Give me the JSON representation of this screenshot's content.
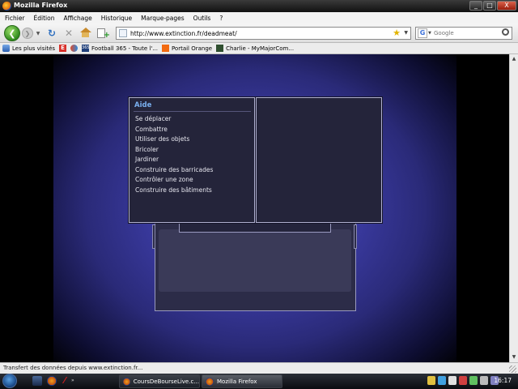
{
  "window": {
    "title": "Mozilla Firefox",
    "buttons": [
      "_",
      "□",
      "X"
    ]
  },
  "menubar": {
    "items": [
      "Fichier",
      "Édition",
      "Affichage",
      "Historique",
      "Marque-pages",
      "Outils",
      "?"
    ]
  },
  "navbar": {
    "back_glyph": "❮",
    "forward_glyph": "❯",
    "dropdown_glyph": "▼",
    "reload_glyph": "↻",
    "stop_glyph": "✕",
    "url": "http://www.extinction.fr/deadmeat/",
    "search_placeholder": "Google",
    "search_engine_glyph": "G",
    "star_glyph": "★"
  },
  "bookmarks": {
    "items": [
      {
        "label": "Les plus visités",
        "icon": "most-visited-icon"
      },
      {
        "label": "",
        "icon": "letter-e-icon",
        "glyph": "E"
      },
      {
        "label": "",
        "icon": "bookmark-multicolor-icon"
      },
      {
        "label": "Football 365 - Toute l'...",
        "icon": "football365-icon",
        "glyph": "365"
      },
      {
        "label": "Portail Orange",
        "icon": "orange-icon"
      },
      {
        "label": "Charlie - MyMajorCom...",
        "icon": "charlie-icon"
      }
    ]
  },
  "game": {
    "help_panel": {
      "title": "Aide",
      "items": [
        "Se déplacer",
        "Combattre",
        "Utiliser des objets",
        "Bricoler",
        "Jardiner",
        "Construire des barricades",
        "Contrôler une zone",
        "Construire des bâtiments"
      ]
    }
  },
  "statusbar": {
    "text": "Transfert des données depuis www.extinction.fr..."
  },
  "taskbar": {
    "tasks": [
      {
        "label": "CoursDeBourseLive.c..."
      },
      {
        "label": "Mozilla Firefox"
      }
    ],
    "clock": "16:17",
    "quicklaunch_more": "»"
  },
  "colors": {
    "page_bg": "#000000",
    "glow": "#4a4ab0",
    "panel_bg": "#24243a",
    "panel_title": "#7ab0f0",
    "menu_text": "#e6e6ee"
  }
}
